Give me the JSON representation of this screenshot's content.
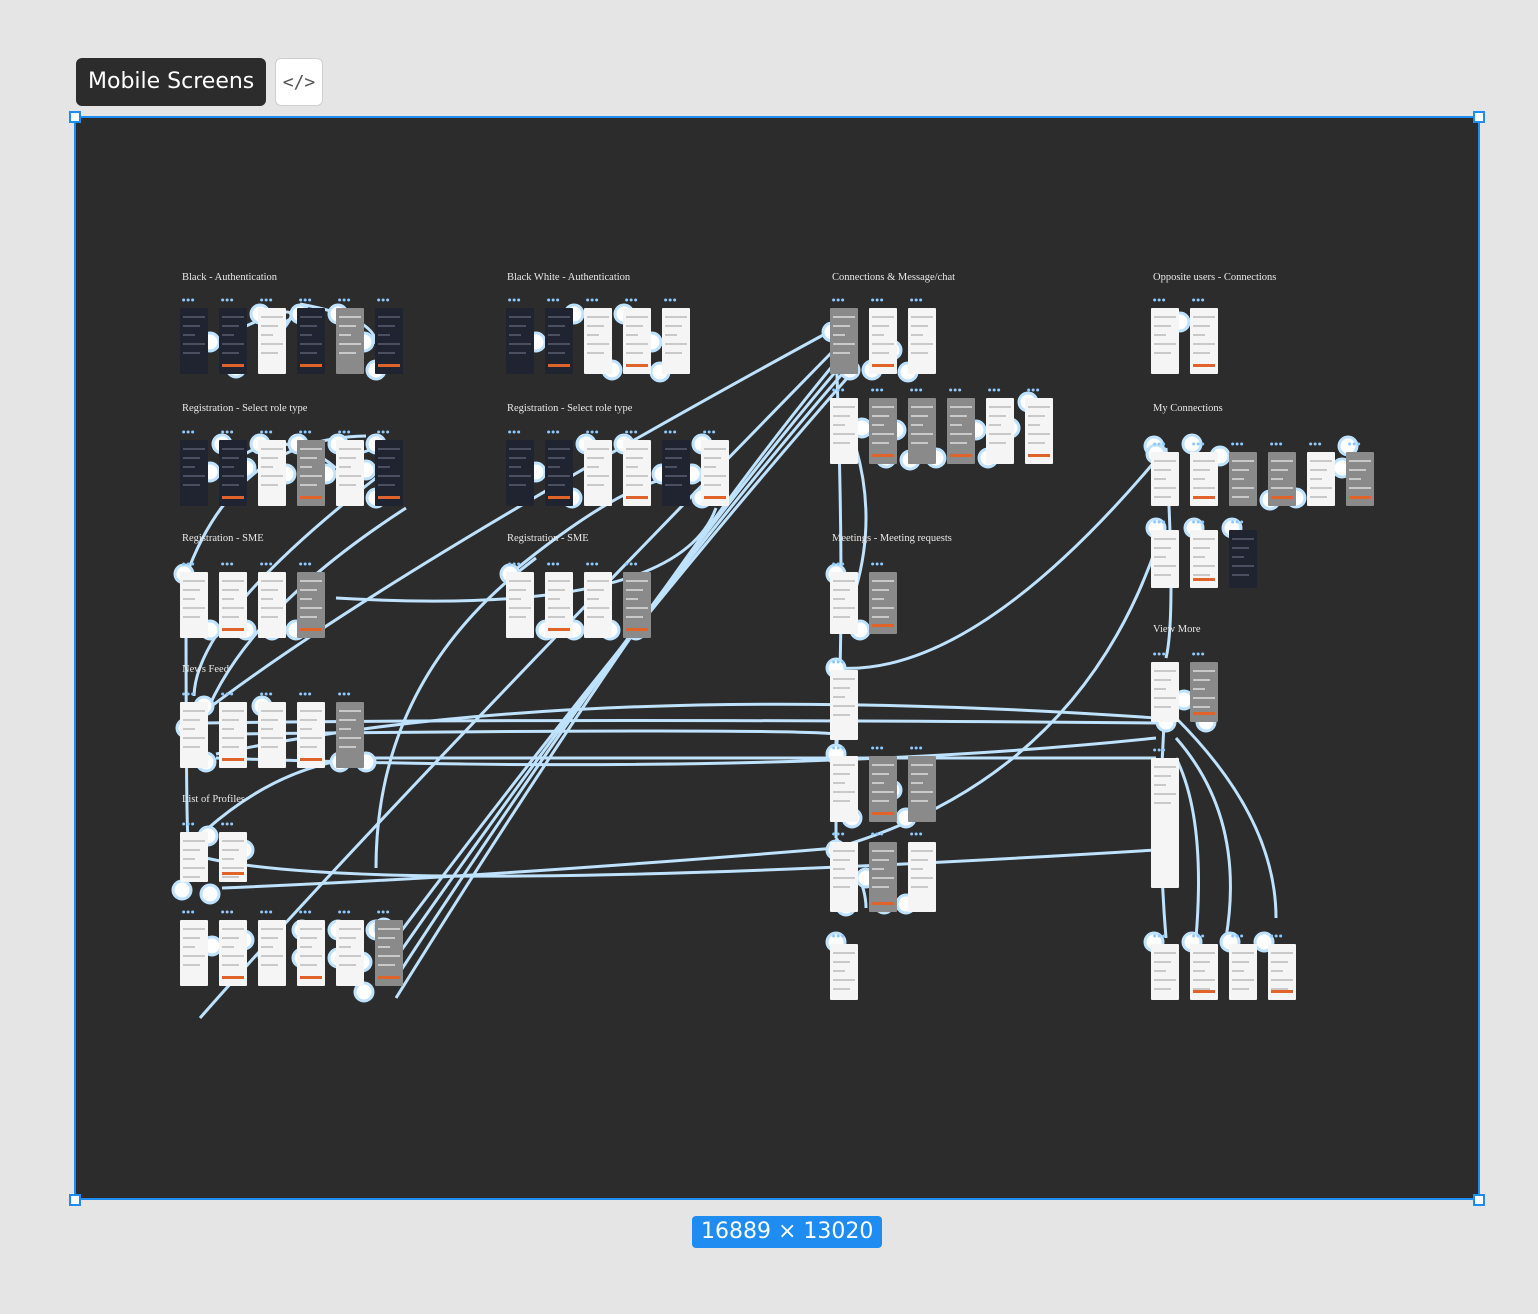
{
  "frame": {
    "label": "Mobile Screens",
    "code_icon": "code-icon",
    "dimensions": "16889 × 13020"
  },
  "colors": {
    "canvas_bg": "#2c2c2c",
    "selection": "#1e8cf0",
    "connector": "#bfe2ff",
    "accent": "#e0642a"
  },
  "sections": [
    {
      "title": "Black - Authentication"
    },
    {
      "title": "Black White  - Authentication"
    },
    {
      "title": "Connections & Message/chat"
    },
    {
      "title": "Opposite users - Connections"
    },
    {
      "title": "Registration - Select role type"
    },
    {
      "title": "Registration - Select role type"
    },
    {
      "title": "My Connections"
    },
    {
      "title": "Registration - SME"
    },
    {
      "title": "Registration - SME"
    },
    {
      "title": "Meetings - Meeting requests"
    },
    {
      "title": "View More"
    },
    {
      "title": "News Feed"
    },
    {
      "title": "List of Profiles"
    }
  ]
}
